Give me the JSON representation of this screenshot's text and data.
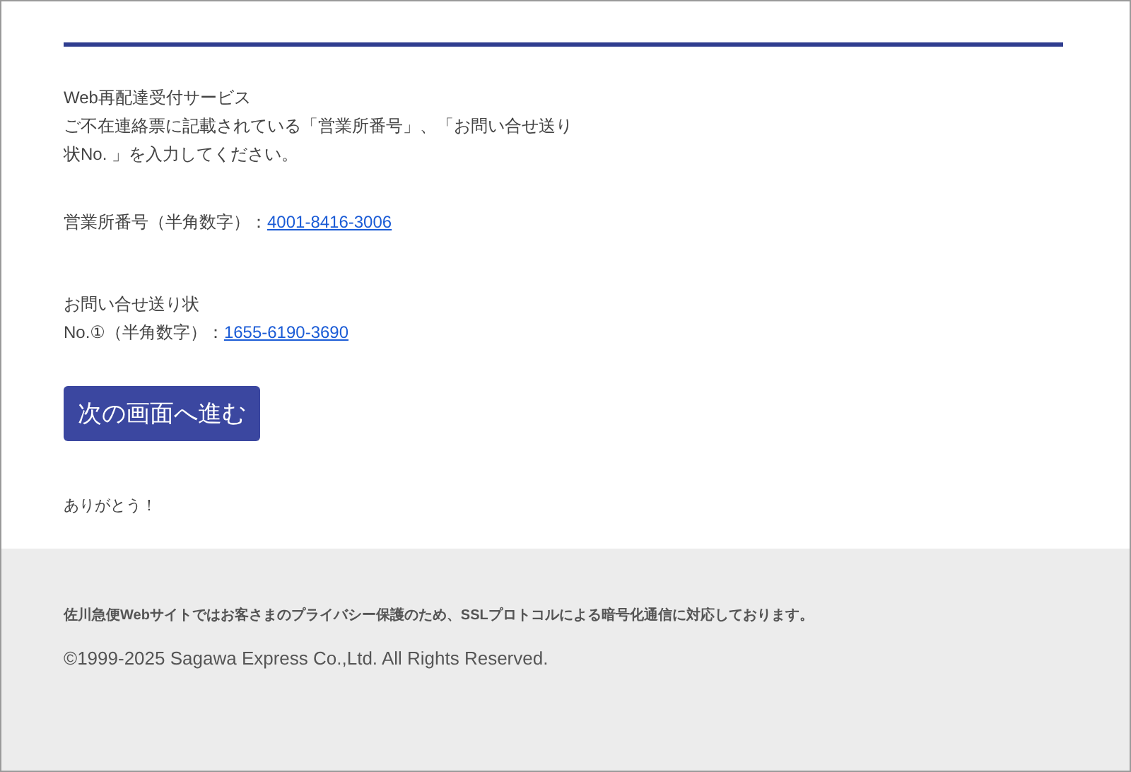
{
  "intro": {
    "title": "Web再配達受付サービス",
    "message": "ご不在連絡票に記載されている「営業所番号」、「お問い合せ送り状No. 」を入力してください。"
  },
  "office": {
    "label": "営業所番号（半角数字）：",
    "value": "4001-8416-3006"
  },
  "tracking": {
    "heading": "お問い合せ送り状",
    "label": "No.①（半角数字）：",
    "value": "1655-6190-3690"
  },
  "button": "次の画面へ進む",
  "thanks": "ありがとう！",
  "footer": {
    "notice": "佐川急便Webサイトではお客さまのプライバシー保護のため、SSLプロトコルによる暗号化通信に対応しております。",
    "copyright": "©1999-2025 Sagawa Express Co.,Ltd. All Rights Reserved."
  }
}
